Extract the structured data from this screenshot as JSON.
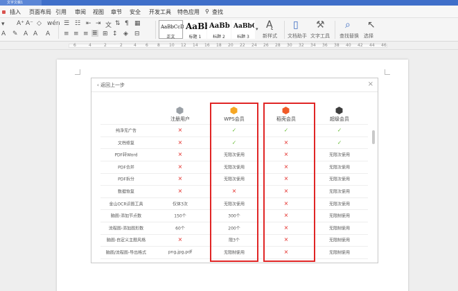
{
  "window": {
    "tab_title": "文字文稿1"
  },
  "menu": {
    "items": [
      "插入",
      "页面布局",
      "引用",
      "审阅",
      "视图",
      "章节",
      "安全",
      "开发工具",
      "特色应用"
    ],
    "search_label": "查找"
  },
  "ribbon": {
    "styles": [
      {
        "sample": "AaBbCcDd",
        "name": "正文"
      },
      {
        "sample": "AaBb",
        "name": "标题 1"
      },
      {
        "sample": "AaBbC",
        "name": "标题 2"
      },
      {
        "sample": "AaBbC",
        "name": "标题 3"
      }
    ],
    "new_style": "新样式",
    "doc_helper": "文档助手",
    "text_tools": "文字工具",
    "find_replace": "查找替换",
    "select": "选择"
  },
  "ruler": {
    "numbers": [
      "6",
      "4",
      "2",
      "2",
      "4",
      "6",
      "8",
      "10",
      "12",
      "14",
      "16",
      "18",
      "20",
      "22",
      "24",
      "26",
      "28",
      "30",
      "32",
      "34",
      "36",
      "38",
      "40",
      "42",
      "44",
      "46"
    ]
  },
  "dialog": {
    "back_label": "返回上一步",
    "close_glyph": "×",
    "columns": [
      "注册用户",
      "WPS会员",
      "稻壳会员",
      "超级会员"
    ],
    "column_colors": [
      "#9aa0a6",
      "#f5a623",
      "#f05a28",
      "#3d3d3d"
    ],
    "rows": [
      {
        "feature": "纯净无广告",
        "values": [
          "✕",
          "✓",
          "✓",
          "✓"
        ]
      },
      {
        "feature": "文档修复",
        "values": [
          "✕",
          "✓",
          "✕",
          "✓"
        ]
      },
      {
        "feature": "PDF转Word",
        "values": [
          "✕",
          "无限次使用",
          "✕",
          "无限次使用"
        ]
      },
      {
        "feature": "PDF合并",
        "values": [
          "✕",
          "无限次使用",
          "✕",
          "无限次使用"
        ]
      },
      {
        "feature": "PDF拆分",
        "values": [
          "✕",
          "无限次使用",
          "✕",
          "无限次使用"
        ]
      },
      {
        "feature": "数据恢复",
        "values": [
          "✕",
          "✕",
          "✕",
          "无限次使用"
        ]
      },
      {
        "feature": "金山OCR识图工具",
        "values": [
          "仅体3次",
          "无限次使用",
          "✕",
          "无限次使用"
        ]
      },
      {
        "feature": "脑图-添加节点数",
        "values": [
          "150个",
          "300个",
          "✕",
          "无限制使用"
        ]
      },
      {
        "feature": "流程图-添加图形数",
        "values": [
          "60个",
          "200个",
          "✕",
          "无限制使用"
        ]
      },
      {
        "feature": "脑图-自定义主题风格",
        "values": [
          "✕",
          "限3个",
          "✕",
          "无限制使用"
        ]
      },
      {
        "feature": "脑图/流程图-导出格式",
        "values": [
          "png,jpg,pdf",
          "无限制使用",
          "✕",
          "无限制使用"
        ]
      }
    ]
  }
}
